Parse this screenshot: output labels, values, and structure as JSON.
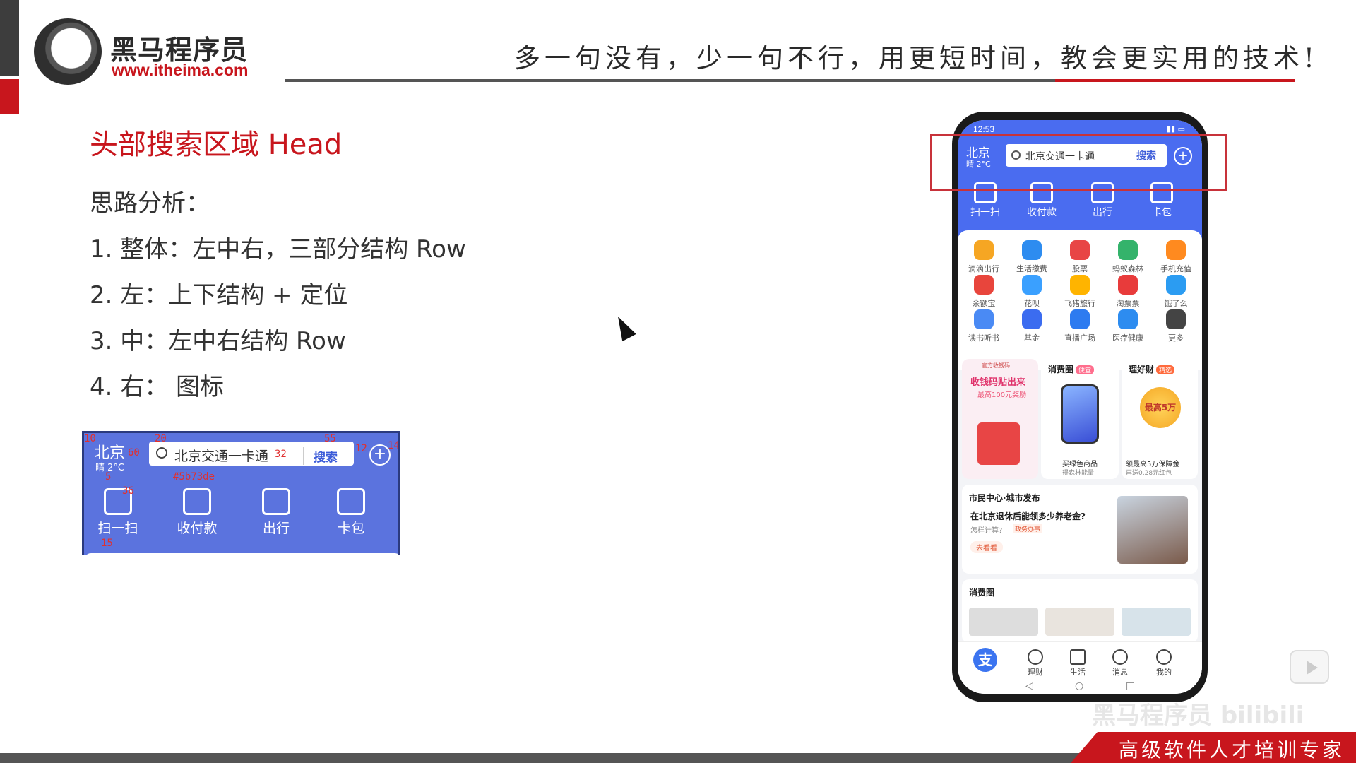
{
  "header": {
    "logo_name": "黑马程序员",
    "logo_url": "www.itheima.com",
    "slogan": "多一句没有，少一句不行，用更短时间，教会更实用的技术!"
  },
  "slide": {
    "title": "头部搜索区域 Head",
    "analysis_title": "思路分析：",
    "points": [
      "1.  整体：左中右，三部分结构 Row",
      "2.  左：上下结构 + 定位",
      "3.  中：左中右结构 Row",
      "4.  右：  图标"
    ]
  },
  "preview": {
    "city": "北京",
    "weather": "晴 2°C",
    "search_text": "北京交通一卡通",
    "search_button": "搜索",
    "tools": [
      "扫一扫",
      "收付款",
      "出行",
      "卡包"
    ],
    "annotations": {
      "a10": "10",
      "a60": "60",
      "a20": "20",
      "a32": "32",
      "a55": "55",
      "a12": "12",
      "a14": "14",
      "a5": "5",
      "a36": "36",
      "color": "#5b73de",
      "a15": "15"
    },
    "accent": "#5b73de"
  },
  "phone": {
    "time": "12:53",
    "city": "北京",
    "weather": "晴 2°C",
    "search_text": "北京交通一卡通",
    "search_button": "搜索",
    "tools": [
      "扫一扫",
      "收付款",
      "出行",
      "卡包"
    ],
    "grid": [
      {
        "label": "滴滴出行",
        "color": "#f6a623"
      },
      {
        "label": "生活缴费",
        "color": "#2d8cf0"
      },
      {
        "label": "股票",
        "color": "#e84545"
      },
      {
        "label": "蚂蚁森林",
        "color": "#34b36b"
      },
      {
        "label": "手机充值",
        "color": "#ff8a1f"
      },
      {
        "label": "余额宝",
        "color": "#e8453c"
      },
      {
        "label": "花呗",
        "color": "#3aa0ff"
      },
      {
        "label": "飞猪旅行",
        "color": "#ffb400"
      },
      {
        "label": "淘票票",
        "color": "#e83b3b"
      },
      {
        "label": "饿了么",
        "color": "#2b9cf2"
      },
      {
        "label": "读书听书",
        "color": "#4a8af4"
      },
      {
        "label": "基金",
        "color": "#3b6cf0"
      },
      {
        "label": "直播广场",
        "color": "#2d7bf0"
      },
      {
        "label": "医疗健康",
        "color": "#2d8cf0"
      },
      {
        "label": "更多",
        "color": "#444444"
      }
    ],
    "promo": {
      "header": "官方收钱码",
      "title": "收钱码贴出来",
      "subtitle": "最高100元奖励"
    },
    "consume": {
      "title": "消费圈",
      "tag": "便宜",
      "product_name": "买绿色商品",
      "product_sub": "得森林能量"
    },
    "finance": {
      "title": "理好财",
      "tag": "精选",
      "badge": "最高5万",
      "line1": "领最高5万保障金",
      "line2": "再送0.28元红包"
    },
    "citizen": {
      "title": "市民中心·城市发布",
      "question": "在北京退休后能领多少养老金?",
      "sub": "怎样计算?",
      "tag": "政务办事",
      "button": "去看看"
    },
    "consume2": {
      "title": "消费圈"
    },
    "nav": [
      "理财",
      "生活",
      "消息",
      "我的"
    ],
    "nav_home_glyph": "支"
  },
  "footer": {
    "text": "高级软件人才培训专家",
    "watermark": "黑马程序员 bilibili"
  }
}
